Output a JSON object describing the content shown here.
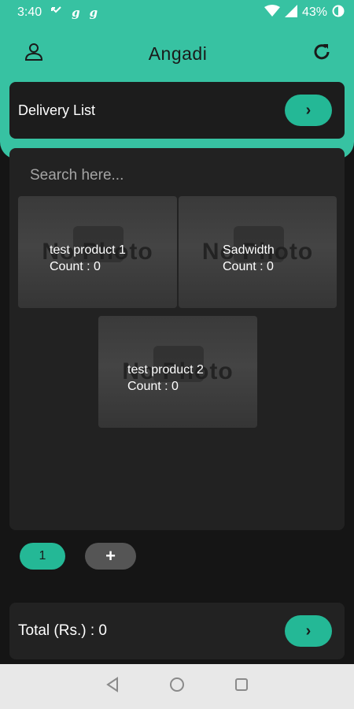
{
  "status_bar": {
    "time": "3:40",
    "battery": "43%"
  },
  "header": {
    "title": "Angadi",
    "profile_icon": "user-icon",
    "refresh_icon": "refresh-icon"
  },
  "delivery": {
    "label": "Delivery List",
    "button_glyph": "›"
  },
  "search": {
    "placeholder": "Search here..."
  },
  "products": [
    {
      "name": "test product 1",
      "count": "Count : 0",
      "image_text": "No Photo"
    },
    {
      "name": "Sadwidth",
      "count": "Count : 0",
      "image_text": "No Photo"
    },
    {
      "name": "test product 2",
      "count": "Count : 0",
      "image_text": "No Photo"
    }
  ],
  "pagination": {
    "current_page": "1",
    "add_label": "+"
  },
  "total": {
    "label": "Total (Rs.) : 0",
    "button_glyph": "›"
  },
  "colors": {
    "accent": "#37c2a2",
    "button": "#24b896",
    "background": "#151515"
  }
}
